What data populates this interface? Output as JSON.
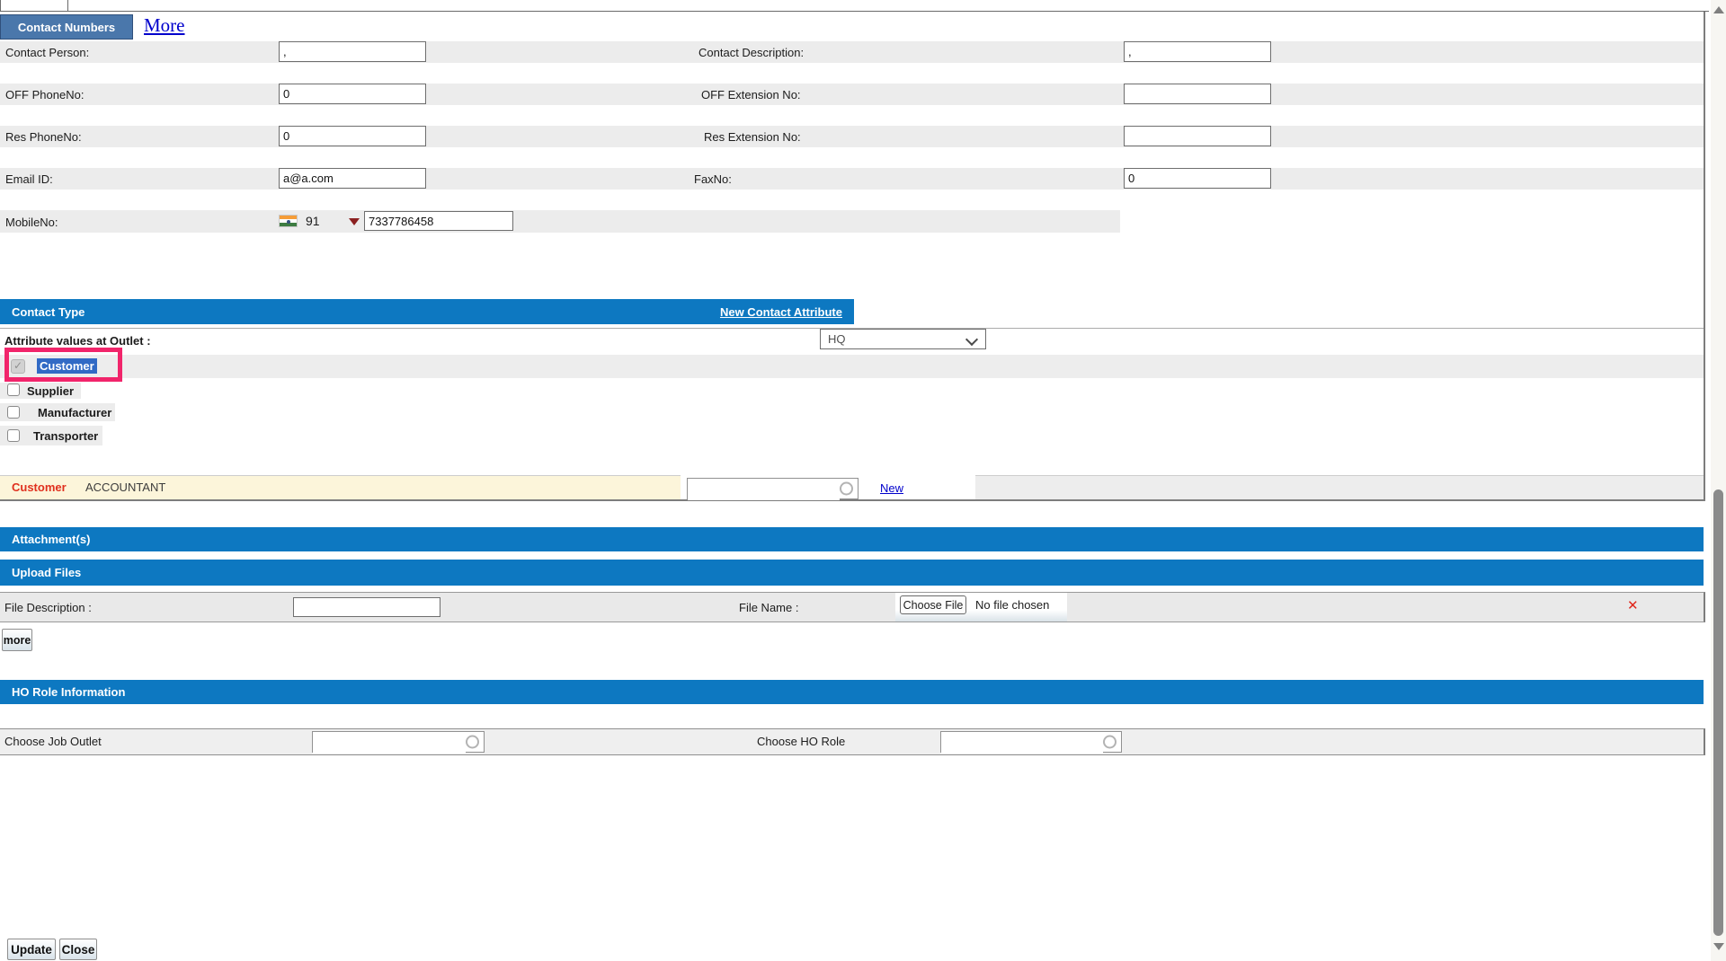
{
  "tab_bar": {
    "active_tab": "Contact Numbers",
    "more_link": "More"
  },
  "contact_numbers": {
    "fields": {
      "contact_person": {
        "label": "Contact Person:",
        "value": ","
      },
      "contact_description": {
        "label": "Contact Description:",
        "value": ","
      },
      "off_phone": {
        "label": "OFF PhoneNo:",
        "value": "0"
      },
      "off_ext": {
        "label": "OFF Extension No:",
        "value": ""
      },
      "res_phone": {
        "label": "Res PhoneNo:",
        "value": "0"
      },
      "res_ext": {
        "label": "Res Extension No:",
        "value": ""
      },
      "email": {
        "label": "Email ID:",
        "value": "a@a.com"
      },
      "fax": {
        "label": "FaxNo:",
        "value": "0"
      },
      "mobile": {
        "label": "MobileNo:",
        "country_code": "91",
        "value": "7337786458"
      }
    }
  },
  "contact_type": {
    "header": "Contact Type",
    "new_attribute_link": "New Contact Attribute",
    "outlet_label": "Attribute values at Outlet :",
    "outlet_selected": "HQ",
    "types": [
      {
        "label": "Customer",
        "checked": true
      },
      {
        "label": "Supplier",
        "checked": false
      },
      {
        "label": "Manufacturer",
        "checked": false
      },
      {
        "label": "Transporter",
        "checked": false
      }
    ],
    "attribute_row": {
      "category": "Customer",
      "value": "ACCOUNTANT",
      "search_value": "",
      "new_link": "New"
    }
  },
  "attachments": {
    "header": "Attachment(s)",
    "upload_header": "Upload Files",
    "file_description_label": "File Description :",
    "file_description_value": "",
    "file_name_label": "File Name :",
    "choose_file_button": "Choose File",
    "no_file_text": "No file chosen",
    "remove_icon": "✕",
    "more_button": "more"
  },
  "ho_role": {
    "header": "HO Role Information",
    "job_outlet_label": "Choose Job Outlet",
    "job_outlet_value": "",
    "ho_role_label": "Choose HO Role",
    "ho_role_value": ""
  },
  "footer": {
    "update_button": "Update",
    "close_button": "Close"
  },
  "icons": {
    "search": "ring-circle",
    "country_flag": "india-flag",
    "mobile_dropdown_arrow": "triangle-down-maroon",
    "select_chevron": "chevron-down",
    "scroll_up": "triangle-up",
    "scroll_down": "triangle-down"
  },
  "colors": {
    "section_bar_blue": "#0d78c1",
    "active_tab_blue": "#4a77ab",
    "highlight_pink": "#f1256b",
    "selection_blue": "#316ac5",
    "category_red": "#e0301e",
    "link_blue": "#0000cc",
    "cream_row": "#fcf5da",
    "row_gray": "#ececec"
  }
}
